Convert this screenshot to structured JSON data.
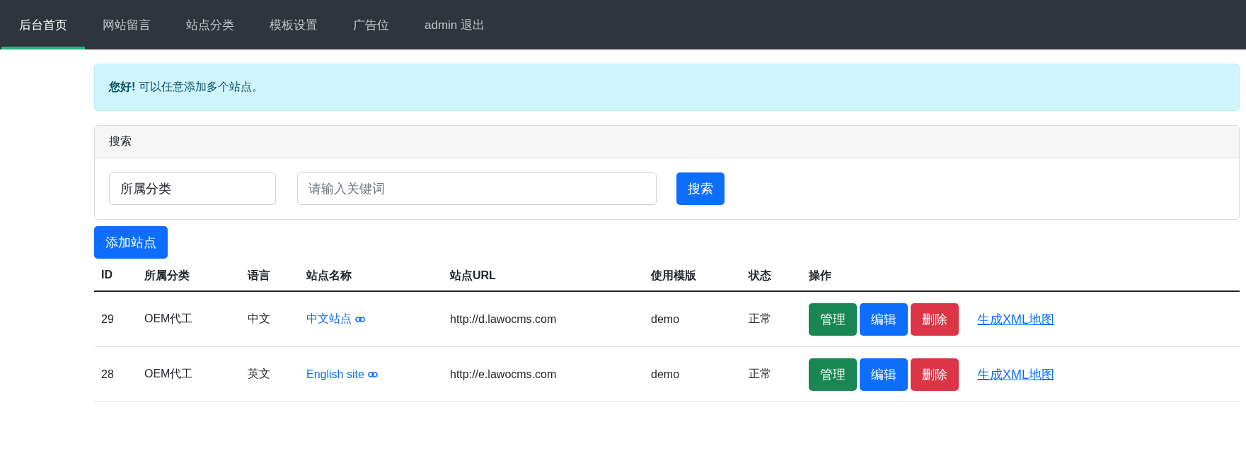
{
  "nav": {
    "items": [
      {
        "label": "后台首页",
        "selected": true
      },
      {
        "label": "网站留言",
        "selected": false
      },
      {
        "label": "站点分类",
        "selected": false
      },
      {
        "label": "模板设置",
        "selected": false
      },
      {
        "label": "广告位",
        "selected": false
      },
      {
        "label": "admin 退出",
        "selected": false
      }
    ]
  },
  "alert": {
    "text": "**您好!** 可以任意添加多个站点。"
  },
  "search": {
    "title": "搜索",
    "category": "所属分类",
    "keyword_placeholder": "请输入关键词",
    "button": "搜索"
  },
  "add_button": "添加站点",
  "table": {
    "columns": [
      "ID",
      "所属分类",
      "语言",
      "站点名称",
      "站点URL",
      "使用模版",
      "状态",
      "操作"
    ],
    "rows": [
      {
        "id": "29",
        "category": "OEM代工",
        "language": "中文",
        "name": "中文站点",
        "url": "http://d.lawocms.com",
        "template": "demo",
        "status": "正常",
        "actions": [
          {
            "label": "管理",
            "kind": "success"
          },
          {
            "label": "编辑",
            "kind": "primary"
          },
          {
            "label": "删除",
            "kind": "danger"
          }
        ],
        "link": "生成XML地图"
      },
      {
        "id": "28",
        "category": "OEM代工",
        "language": "英文",
        "name": "English site",
        "url": "http://e.lawocms.com",
        "template": "demo",
        "status": "正常",
        "actions": [
          {
            "label": "管理",
            "kind": "success"
          },
          {
            "label": "编辑",
            "kind": "primary"
          },
          {
            "label": "删除",
            "kind": "danger"
          }
        ],
        "link": "生成XML地图"
      }
    ]
  }
}
